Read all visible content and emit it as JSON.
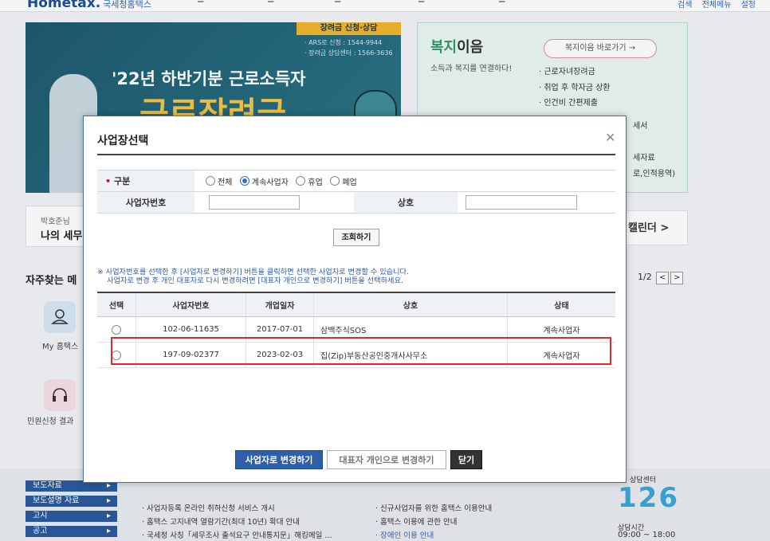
{
  "header": {
    "logo": "Hometax.",
    "logo_sub": "국세청홈택스",
    "util_links": [
      "검색",
      "전체메뉴",
      "설정"
    ]
  },
  "banner": {
    "tag": "장려금 신청·상담",
    "phone1": "· ARS로 신청 : 1544-9944",
    "phone2": "· 장려금 상담센터 : 1566-3636",
    "title": "'22년 하반기분 근로소득자",
    "big": "근로장려금"
  },
  "welfare": {
    "title_accent": "복지",
    "title_rest": "이음",
    "subtitle": "소득과 복지를 연결하다!",
    "button": "복지이음 바로가기 →",
    "items": [
      "· 근로자녀장려금",
      "· 취업 후 학자금 상환",
      "· 인건비 간편제출"
    ],
    "cut1": "세서",
    "cut2": "세자료",
    "cut3": "로,인적용역)"
  },
  "user": {
    "name": "박호준님",
    "my": "나의 세무"
  },
  "calendar_label": "캘린더  >",
  "favorites": {
    "title": "자주찾는 메",
    "pager": "1/2",
    "items": [
      "My 홈택스",
      "민원신청 결과"
    ]
  },
  "lower": {
    "menu": [
      "보도자료",
      "보도설명 자료",
      "고시",
      "공고"
    ],
    "news_left": [
      "· 사업자등록 온라인 취하신청 서비스 개시",
      "· 홈택스 고지내역 열람기간(최대 10년) 확대 안내",
      "· 국세청 사칭「세무조사 출석요구 안내통지문」해킹메일 ..."
    ],
    "news_right": [
      "· 신규사업자를 위한 홈택스 이용안내",
      "· 홈택스 이용에 관한 안내",
      "· 장애인 이용 안내"
    ],
    "call_label": "상담센터",
    "call_number": "126",
    "call_hours_label": "상담시간",
    "call_hours": "09:00 ~ 18:00"
  },
  "modal": {
    "title": "사업장선택",
    "form": {
      "type_label": "구분",
      "options": [
        "전체",
        "계속사업자",
        "휴업",
        "폐업"
      ],
      "selected_option": "계속사업자",
      "bizno_label": "사업자번호",
      "bizno_value": "",
      "name_label": "상호",
      "name_value": ""
    },
    "search_button": "조회하기",
    "notice_line1": "※ 사업자번호를 선택한 후 [사업자로 변경하기] 버튼을 클릭하면 선택한 사업자로 변경할 수 있습니다.",
    "notice_line2": "사업자로 변경 후 개인 대표자로 다시 변경하려면 [대표자 개인으로 변경하기] 버튼을 선택하세요.",
    "columns": [
      "선택",
      "사업자번호",
      "개업일자",
      "상호",
      "상태"
    ],
    "rows": [
      {
        "bizno": "102-06-11635",
        "date": "2017-07-01",
        "name": "삼백주식SOS",
        "status": "계속사업자"
      },
      {
        "bizno": "197-09-02377",
        "date": "2023-02-03",
        "name": "집(Zip)부동산공인중개사사무소",
        "status": "계속사업자"
      }
    ],
    "buttons": {
      "change": "사업자로 변경하기",
      "rep": "대표자 개인으로 변경하기",
      "close": "닫기"
    }
  },
  "colors": {
    "accent": "#2e5fa8",
    "highlight": "#e5262b",
    "required": "#d0021b"
  }
}
